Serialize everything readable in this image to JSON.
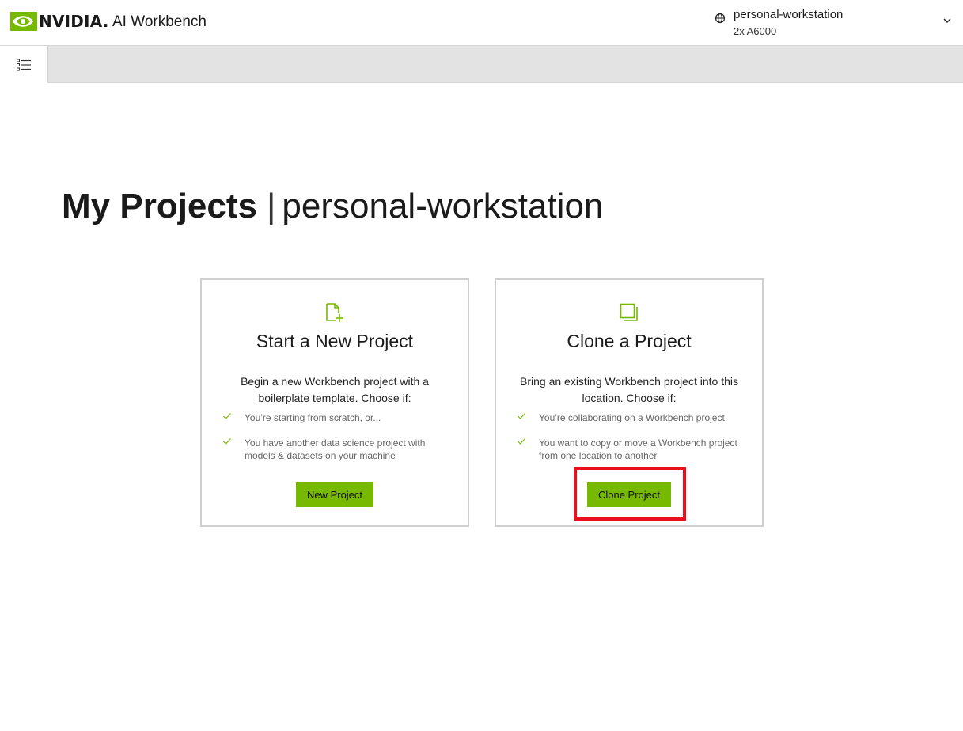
{
  "header": {
    "brand": "NVIDIA.",
    "app_title": "AI Workbench",
    "location": {
      "name": "personal-workstation",
      "gpu": "2x A6000",
      "icon": "globe-icon",
      "dropdown_icon": "chevron-down-icon"
    }
  },
  "toolbar": {
    "menu_icon": "list-icon"
  },
  "page": {
    "title_strong": "My Projects",
    "title_sep": "|",
    "title_location": "personal-workstation"
  },
  "cards": [
    {
      "icon": "new-file-icon",
      "title": "Start a New Project",
      "description": "Begin a new Workbench project with a boilerplate template. Choose if:",
      "checks": [
        "You’re starting from scratch, or...",
        "You have another data science project with models & datasets on your machine"
      ],
      "button": "New Project"
    },
    {
      "icon": "copy-icon",
      "title": "Clone a Project",
      "description": "Bring an existing Workbench project into this location. Choose if:",
      "checks": [
        "You’re collaborating on a Workbench project",
        "You want to copy or move a Workbench project from one location to another"
      ],
      "button": "Clone Project"
    }
  ],
  "colors": {
    "accent": "#76b900",
    "highlight": "#e8101c",
    "toolbar_bg": "#e3e3e3"
  }
}
